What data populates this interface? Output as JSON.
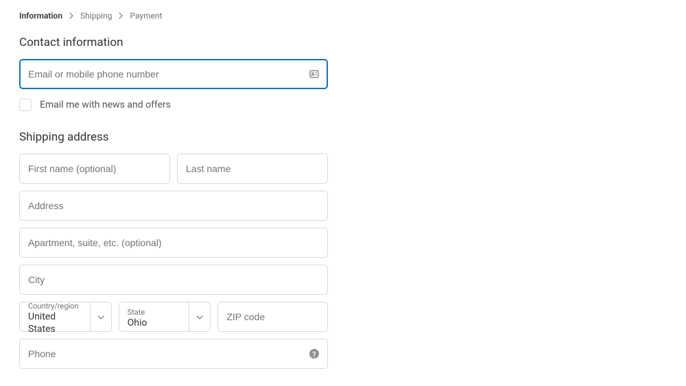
{
  "breadcrumb": {
    "information": "Information",
    "shipping": "Shipping",
    "payment": "Payment"
  },
  "contact": {
    "heading": "Contact information",
    "email_placeholder": "Email or mobile phone number",
    "email_value": "",
    "news_label": "Email me with news and offers"
  },
  "shipping": {
    "heading": "Shipping address",
    "first_name_placeholder": "First name (optional)",
    "last_name_placeholder": "Last name",
    "address_placeholder": "Address",
    "apt_placeholder": "Apartment, suite, etc. (optional)",
    "city_placeholder": "City",
    "country_label": "Country/region",
    "country_value": "United States",
    "state_label": "State",
    "state_value": "Ohio",
    "zip_placeholder": "ZIP code",
    "phone_placeholder": "Phone"
  }
}
